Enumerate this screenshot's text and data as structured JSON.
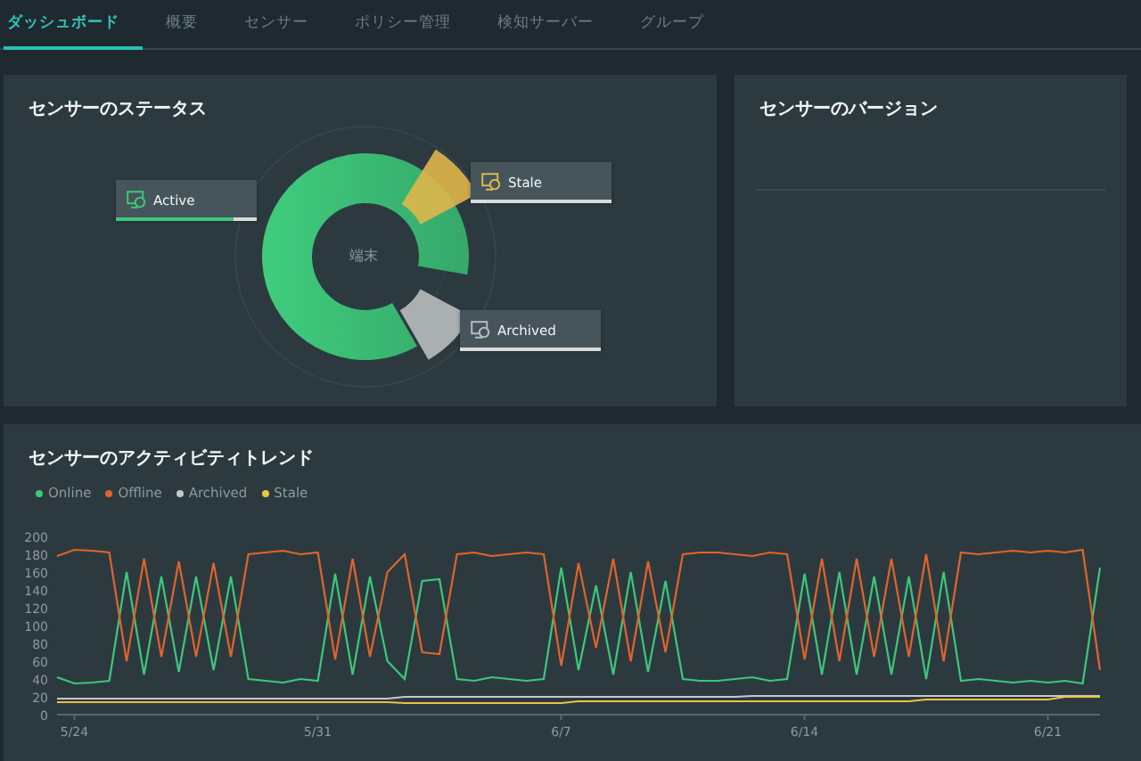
{
  "tabs": [
    {
      "label": "ダッシュボード",
      "selected": true
    },
    {
      "label": "概要",
      "selected": false
    },
    {
      "label": "センサー",
      "selected": false
    },
    {
      "label": "ポリシー管理",
      "selected": false
    },
    {
      "label": "検知サーバー",
      "selected": false
    },
    {
      "label": "グループ",
      "selected": false
    }
  ],
  "status_panel": {
    "title": "センサーのステータス",
    "center_label": "端末",
    "statuses": [
      {
        "kind": "active",
        "label": "Active",
        "color": "#3ec77a"
      },
      {
        "kind": "stale",
        "label": "Stale",
        "color": "#e0b64a"
      },
      {
        "kind": "archived",
        "label": "Archived",
        "color": "#b8bcbe"
      }
    ]
  },
  "version_panel": {
    "title": "センサーのバージョン"
  },
  "trend_panel": {
    "title": "センサーのアクティビティトレンド",
    "chart_data": {
      "type": "line",
      "categories": [
        null,
        "5/24",
        null,
        null,
        null,
        null,
        null,
        null,
        null,
        null,
        null,
        null,
        null,
        null,
        null,
        "5/31",
        null,
        null,
        null,
        null,
        null,
        null,
        null,
        null,
        null,
        null,
        null,
        null,
        null,
        "6/7",
        null,
        null,
        null,
        null,
        null,
        null,
        null,
        null,
        null,
        null,
        null,
        null,
        null,
        "6/14",
        null,
        null,
        null,
        null,
        null,
        null,
        null,
        null,
        null,
        null,
        null,
        null,
        null,
        "6/21",
        null,
        null,
        null
      ],
      "series": [
        {
          "name": "Online",
          "color": "#3ec77a",
          "values": [
            42,
            35,
            36,
            38,
            160,
            45,
            155,
            48,
            155,
            50,
            155,
            40,
            38,
            36,
            40,
            38,
            158,
            45,
            155,
            60,
            40,
            150,
            152,
            40,
            38,
            42,
            40,
            38,
            40,
            165,
            50,
            145,
            45,
            160,
            48,
            150,
            40,
            38,
            38,
            40,
            42,
            38,
            40,
            158,
            45,
            160,
            45,
            155,
            45,
            155,
            40,
            160,
            38,
            40,
            38,
            36,
            38,
            36,
            38,
            35,
            165
          ]
        },
        {
          "name": "Offline",
          "color": "#e0642a",
          "values": [
            178,
            185,
            184,
            182,
            60,
            175,
            65,
            172,
            65,
            170,
            65,
            180,
            182,
            184,
            180,
            182,
            62,
            175,
            65,
            160,
            180,
            70,
            68,
            180,
            182,
            178,
            180,
            182,
            180,
            55,
            170,
            75,
            175,
            60,
            172,
            70,
            180,
            182,
            182,
            180,
            178,
            182,
            180,
            62,
            175,
            60,
            175,
            65,
            175,
            65,
            180,
            60,
            182,
            180,
            182,
            184,
            182,
            184,
            182,
            185,
            50
          ]
        },
        {
          "name": "Archived",
          "color": "#c4c8ca",
          "values": [
            18,
            18,
            18,
            18,
            18,
            18,
            18,
            18,
            18,
            18,
            18,
            18,
            18,
            18,
            18,
            18,
            18,
            18,
            18,
            18,
            20,
            20,
            20,
            20,
            20,
            20,
            20,
            20,
            20,
            20,
            20,
            20,
            20,
            20,
            20,
            20,
            20,
            20,
            20,
            20,
            21,
            21,
            21,
            21,
            21,
            21,
            21,
            21,
            21,
            21,
            21,
            21,
            21,
            21,
            21,
            21,
            21,
            21,
            21,
            21,
            21
          ]
        },
        {
          "name": "Stale",
          "color": "#e8c447",
          "values": [
            14,
            14,
            14,
            14,
            14,
            14,
            14,
            14,
            14,
            14,
            14,
            14,
            14,
            14,
            14,
            14,
            14,
            14,
            14,
            14,
            13,
            13,
            13,
            13,
            13,
            13,
            13,
            13,
            13,
            13,
            15,
            15,
            15,
            15,
            15,
            15,
            15,
            15,
            15,
            15,
            15,
            15,
            15,
            15,
            15,
            15,
            15,
            15,
            15,
            15,
            17,
            17,
            17,
            17,
            17,
            17,
            17,
            17,
            20,
            20,
            20
          ]
        }
      ],
      "ylim": [
        0,
        200
      ],
      "yticks": [
        0,
        20,
        40,
        60,
        80,
        100,
        120,
        140,
        160,
        180,
        200
      ]
    }
  }
}
